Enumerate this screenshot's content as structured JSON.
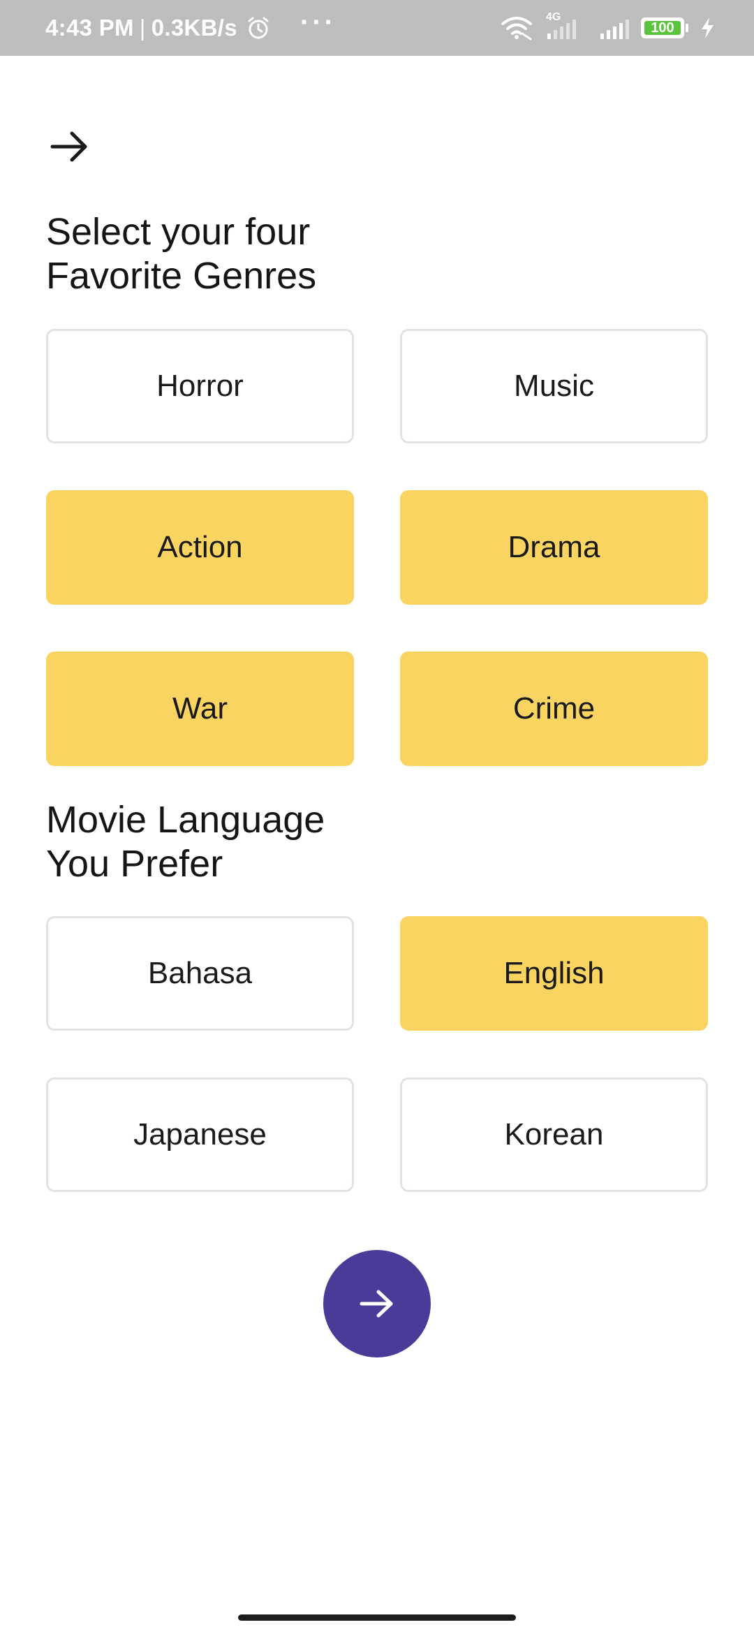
{
  "status_bar": {
    "time": "4:43 PM",
    "separator": "|",
    "speed": "0.3KB/s",
    "more_dots": "···",
    "network_type": "4G",
    "battery_level": "100",
    "background_color": "#bdbdbd"
  },
  "genres": {
    "heading": "Select your four\n Favorite Genres",
    "options": [
      {
        "label": "Horror",
        "selected": false
      },
      {
        "label": "Music",
        "selected": false
      },
      {
        "label": "Action",
        "selected": true
      },
      {
        "label": "Drama",
        "selected": true
      },
      {
        "label": "War",
        "selected": true
      },
      {
        "label": "Crime",
        "selected": true
      }
    ]
  },
  "language": {
    "heading": "Movie Language\nYou Prefer",
    "options": [
      {
        "label": "Bahasa",
        "selected": false
      },
      {
        "label": "English",
        "selected": true
      },
      {
        "label": "Japanese",
        "selected": false
      },
      {
        "label": "Korean",
        "selected": false
      }
    ]
  },
  "icons": {
    "top_arrow": "arrow-right-icon",
    "fab_arrow": "arrow-right-icon",
    "alarm": "alarm-clock-icon",
    "wifi": "wifi-icon",
    "signal": "cell-signal-icon",
    "charging": "lightning-bolt-icon"
  },
  "colors": {
    "selected_fill": "#f9d461",
    "unselected_border": "#e2e2e2",
    "fab": "#4b3b98",
    "text": "#151515",
    "battery_fill": "#5cc43a"
  }
}
